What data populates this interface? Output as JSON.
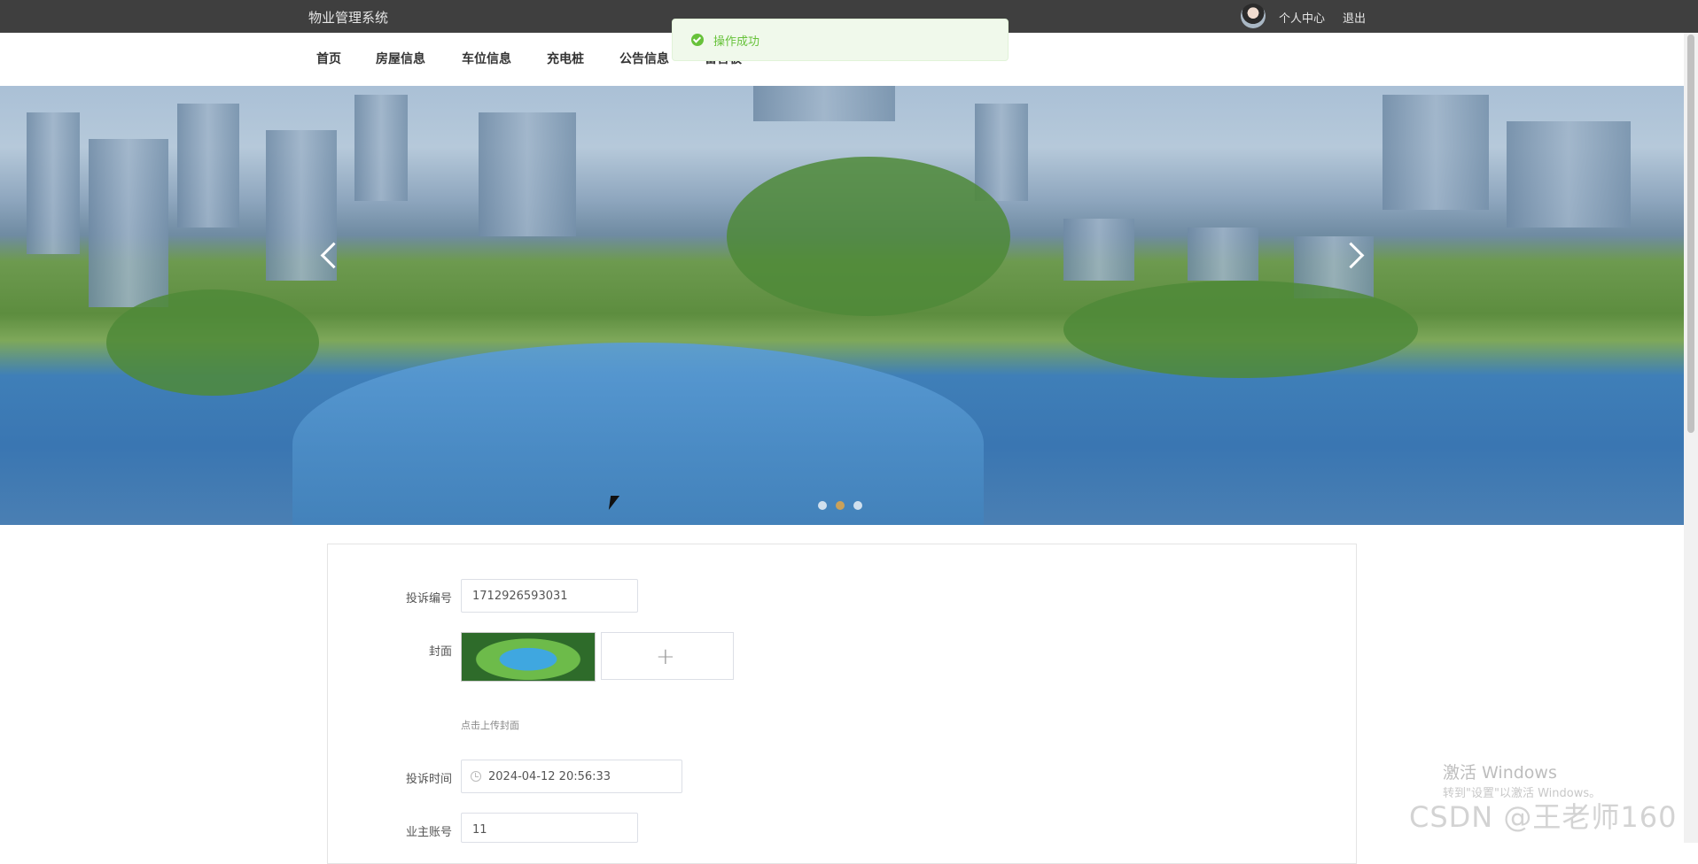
{
  "app": {
    "title": "物业管理系统"
  },
  "user_menu": {
    "profile": "个人中心",
    "logout": "退出"
  },
  "nav": {
    "items": [
      "首页",
      "房屋信息",
      "车位信息",
      "充电桩",
      "公告信息",
      "留言板"
    ]
  },
  "toast": {
    "message": "操作成功",
    "type": "success",
    "color": "#67c23a"
  },
  "carousel": {
    "slide_count": 3,
    "active_index": 1
  },
  "form": {
    "complaint_no": {
      "label": "投诉编号",
      "value": "1712926593031"
    },
    "cover": {
      "label": "封面",
      "upload_symbol": "+",
      "hint": "点击上传封面"
    },
    "complaint_time": {
      "label": "投诉时间",
      "value": "2024-04-12 20:56:33"
    },
    "owner_account": {
      "label": "业主账号",
      "value": "11"
    }
  },
  "watermarks": {
    "windows_title": "激活 Windows",
    "windows_sub": "转到\"设置\"以激活 Windows。",
    "csdn": "CSDN @王老师160"
  }
}
